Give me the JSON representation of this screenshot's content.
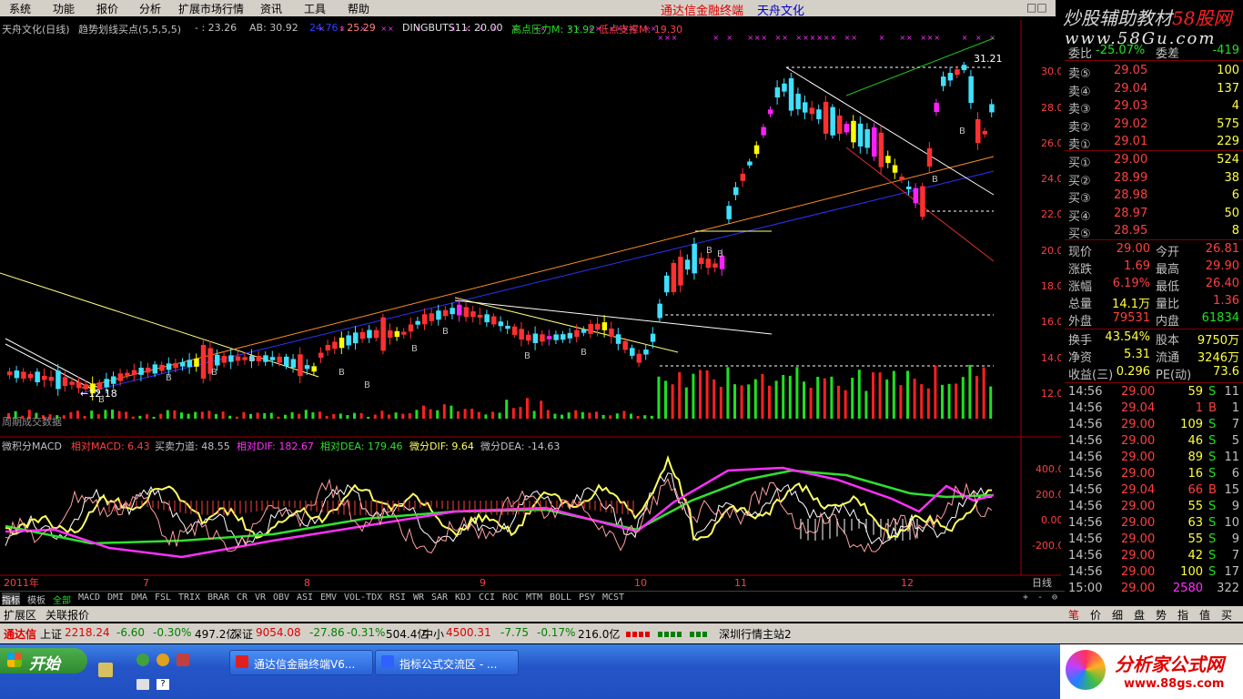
{
  "menu": [
    "系统",
    "功能",
    "报价",
    "分析",
    "扩展市场行情",
    "资讯",
    "工具",
    "帮助"
  ],
  "app_title": "通达信金融终端",
  "stock_title": "天舟文化",
  "window_ctrl": "□□",
  "brand": {
    "line1a": "炒股辅助教材",
    "line1b": "58股网",
    "line2": "www.58Gu.com"
  },
  "header": {
    "name": "天舟文化(日线)",
    "indicator": "趋势划线买点(5,5,5,5)",
    "v1": "-  : 23.26",
    "v2": "AB: 30.92",
    "v3": "24.76",
    "v4": ": 25.29",
    "ding": "DINGBUTS11: 20.00",
    "high_label": "高点压力M: 31.92",
    "low_label": "低点支撑M: 19.30",
    "vol_label": "周期成交数据"
  },
  "price_axis": [
    "30.00",
    "28.00",
    "26.00",
    "24.00",
    "22.00",
    "20.00",
    "18.00",
    "16.00",
    "14.00",
    "12.00"
  ],
  "annotations": {
    "low": "←12.18",
    "high": "31.21",
    "b": "B"
  },
  "macd_header": {
    "title": "微积分MACD",
    "m1": "相对MACD: 6.43",
    "m2": "买卖力道: 48.55",
    "m3": "相对DIF: 182.67",
    "m4": "相对DEA: 179.46",
    "m5": "微分DIF: 9.64",
    "m6": "微分DEA: -14.63"
  },
  "macd_axis": [
    "400.0",
    "200.0",
    "0.00",
    "-200.0"
  ],
  "date_axis": [
    "2011年",
    "7",
    "8",
    "9",
    "10",
    "11",
    "12"
  ],
  "period_label": "日线",
  "tabs": [
    "指标",
    "模板",
    "全部",
    "MACD",
    "DMI",
    "DMA",
    "FSL",
    "TRIX",
    "BRAR",
    "CR",
    "VR",
    "OBV",
    "ASI",
    "EMV",
    "VOL-TDX",
    "RSI",
    "WR",
    "SAR",
    "KDJ",
    "CCI",
    "ROC",
    "MTM",
    "BOLL",
    "PSY",
    "MCST"
  ],
  "tab_ctrl": [
    "+",
    "-",
    "⊖"
  ],
  "ext_tabs": [
    "扩展区",
    "关联报价"
  ],
  "quote": {
    "top_label": "委比",
    "top_val": "-25.07%",
    "top_label2": "委差",
    "top_val2": "-419",
    "asks": [
      {
        "l": "卖⑤",
        "p": "29.05",
        "v": "100"
      },
      {
        "l": "卖④",
        "p": "29.04",
        "v": "137"
      },
      {
        "l": "卖③",
        "p": "29.03",
        "v": "4"
      },
      {
        "l": "卖②",
        "p": "29.02",
        "v": "575"
      },
      {
        "l": "卖①",
        "p": "29.01",
        "v": "229"
      }
    ],
    "bids": [
      {
        "l": "买①",
        "p": "29.00",
        "v": "524"
      },
      {
        "l": "买②",
        "p": "28.99",
        "v": "38"
      },
      {
        "l": "买③",
        "p": "28.98",
        "v": "6"
      },
      {
        "l": "买④",
        "p": "28.97",
        "v": "50"
      },
      {
        "l": "买⑤",
        "p": "28.95",
        "v": "8"
      }
    ],
    "stats": [
      {
        "a": "现价",
        "b": "29.00",
        "c": "今开",
        "d": "26.81"
      },
      {
        "a": "涨跌",
        "b": "1.69",
        "c": "最高",
        "d": "29.90"
      },
      {
        "a": "涨幅",
        "b": "6.19%",
        "c": "最低",
        "d": "26.40"
      },
      {
        "a": "总量",
        "b": "14.1万",
        "c": "量比",
        "d": "1.36"
      },
      {
        "a": "外盘",
        "b": "79531",
        "c": "内盘",
        "d": "61834"
      }
    ],
    "stats2": [
      {
        "a": "换手",
        "b": "43.54%",
        "c": "股本",
        "d": "9750万"
      },
      {
        "a": "净资",
        "b": "5.31",
        "c": "流通",
        "d": "3246万"
      },
      {
        "a": "收益(三)",
        "b": "0.296",
        "c": "PE(动)",
        "d": "73.6"
      }
    ],
    "ticks": [
      {
        "t": "14:56",
        "p": "29.00",
        "v": "59",
        "s": "S",
        "n": "11"
      },
      {
        "t": "14:56",
        "p": "29.04",
        "v": "1",
        "s": "B",
        "n": "1"
      },
      {
        "t": "14:56",
        "p": "29.00",
        "v": "109",
        "s": "S",
        "n": "7"
      },
      {
        "t": "14:56",
        "p": "29.00",
        "v": "46",
        "s": "S",
        "n": "5"
      },
      {
        "t": "14:56",
        "p": "29.00",
        "v": "89",
        "s": "S",
        "n": "11"
      },
      {
        "t": "14:56",
        "p": "29.00",
        "v": "16",
        "s": "S",
        "n": "6"
      },
      {
        "t": "14:56",
        "p": "29.04",
        "v": "66",
        "s": "B",
        "n": "15"
      },
      {
        "t": "14:56",
        "p": "29.00",
        "v": "55",
        "s": "S",
        "n": "9"
      },
      {
        "t": "14:56",
        "p": "29.00",
        "v": "63",
        "s": "S",
        "n": "10"
      },
      {
        "t": "14:56",
        "p": "29.00",
        "v": "55",
        "s": "S",
        "n": "9"
      },
      {
        "t": "14:56",
        "p": "29.00",
        "v": "42",
        "s": "S",
        "n": "7"
      },
      {
        "t": "14:56",
        "p": "29.00",
        "v": "100",
        "s": "S",
        "n": "17"
      },
      {
        "t": "15:00",
        "p": "29.00",
        "v": "2580",
        "s": "",
        "n": "322"
      }
    ],
    "side_tabs": [
      "笔",
      "价",
      "细",
      "盘",
      "势",
      "指",
      "值",
      "买"
    ]
  },
  "status": {
    "brand": "通达信",
    "sh": "上证",
    "sh_v": "2218.24",
    "sh_c": "-6.60",
    "sh_p": "-0.30%",
    "sh_a": "497.2亿",
    "sz": "深证",
    "sz_v": "9054.08",
    "sz_c": "-27.86",
    "sz_p": "-0.31%",
    "sz_a": "504.4亿",
    "zx": "中小",
    "zx_v": "4500.31",
    "zx_c": "-7.75",
    "zx_p": "-0.17%",
    "zx_a": "216.0亿",
    "server": "深圳行情主站2"
  },
  "taskbar": {
    "start": "开始",
    "t1": "通达信金融终端V6...",
    "t2": "指标公式交流区 - ...",
    "ad1": "分析家公式网",
    "ad2": "www.88gs.com"
  }
}
